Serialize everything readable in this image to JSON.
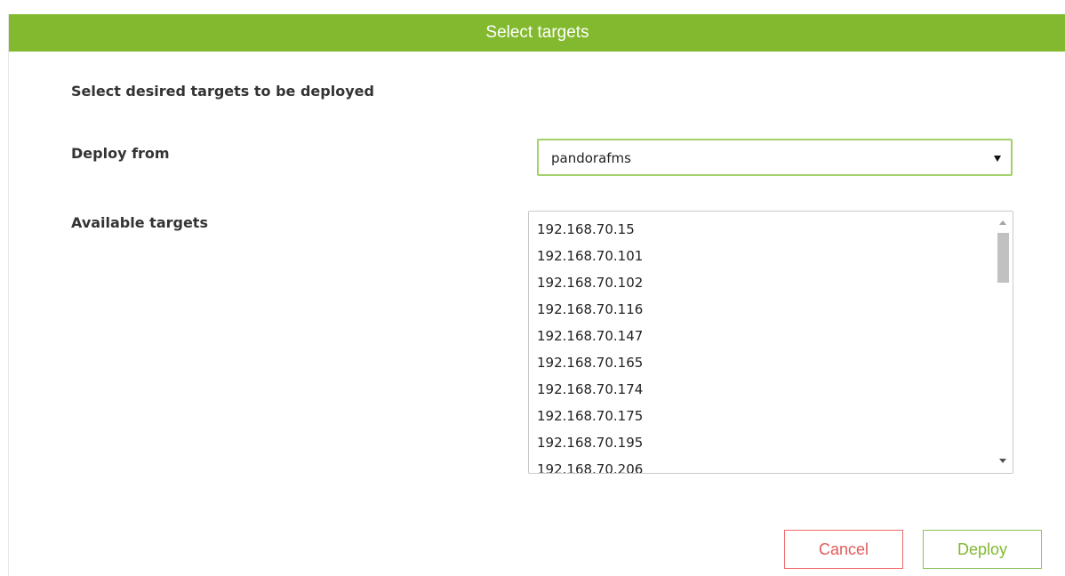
{
  "dialog": {
    "title": "Select targets",
    "instruction": "Select desired targets to be deployed"
  },
  "form": {
    "deploy_from_label": "Deploy from",
    "deploy_from_value": "pandorafms",
    "available_targets_label": "Available targets",
    "available_targets": [
      "192.168.70.15",
      "192.168.70.101",
      "192.168.70.102",
      "192.168.70.116",
      "192.168.70.147",
      "192.168.70.165",
      "192.168.70.174",
      "192.168.70.175",
      "192.168.70.195",
      "192.168.70.206"
    ]
  },
  "buttons": {
    "cancel_label": "Cancel",
    "deploy_label": "Deploy"
  },
  "icons": {
    "select_arrow": "caret-down-icon",
    "scroll_up": "scroll-up-arrow-icon",
    "scroll_down": "scroll-down-arrow-icon"
  },
  "colors": {
    "header_background": "#82b92e",
    "select_border": "#a2d06a",
    "cancel_accent": "#e35b5b",
    "deploy_accent": "#82b92e"
  }
}
